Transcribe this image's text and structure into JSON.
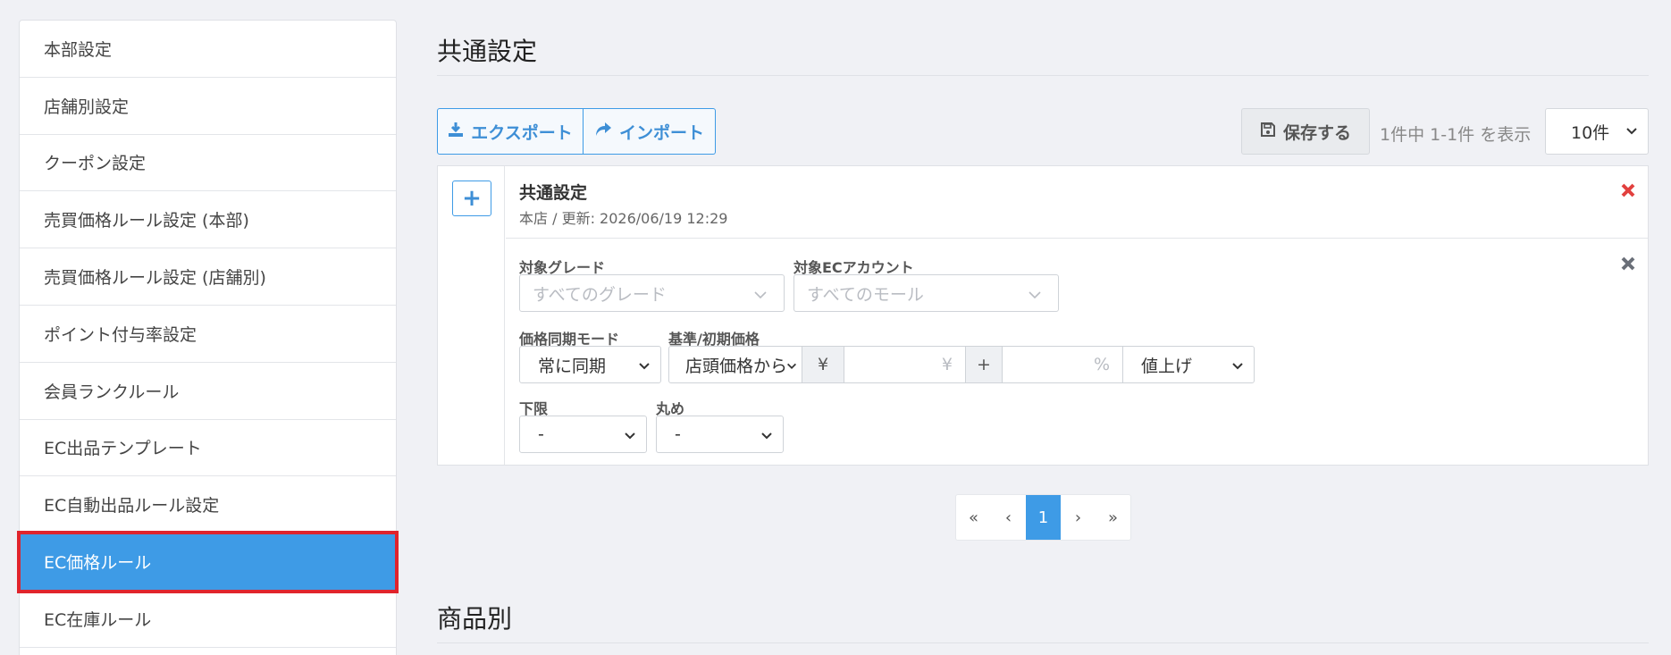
{
  "sidebar": {
    "items": [
      {
        "label": "本部設定"
      },
      {
        "label": "店舗別設定"
      },
      {
        "label": "クーポン設定"
      },
      {
        "label": "売買価格ルール設定 (本部)"
      },
      {
        "label": "売買価格ルール設定 (店舗別)"
      },
      {
        "label": "ポイント付与率設定"
      },
      {
        "label": "会員ランクルール"
      },
      {
        "label": "EC出品テンプレート"
      },
      {
        "label": "EC自動出品ルール設定"
      },
      {
        "label": "EC価格ルール"
      },
      {
        "label": "EC在庫ルール"
      }
    ],
    "active_index": 9
  },
  "main": {
    "section1_title": "共通設定",
    "export_label": "エクスポート",
    "import_label": "インポート",
    "save_label": "保存する",
    "count_text": "1件中 1-1件 を表示",
    "per_page": "10件",
    "card": {
      "plus": "+",
      "title": "共通設定",
      "meta": "本店 / 更新: 2026/06/19 12:29",
      "grade_label": "対象グレード",
      "grade_placeholder": "すべてのグレード",
      "ec_account_label": "対象ECアカウント",
      "ec_account_placeholder": "すべてのモール",
      "sync_mode_label": "価格同期モード",
      "sync_mode_value": "常に同期",
      "base_price_label": "基準/初期価格",
      "base_price_value": "店頭価格から",
      "yen_addon": "¥",
      "yen_placeholder": "¥",
      "plus_addon": "+",
      "percent_placeholder": "%",
      "direction_value": "値上げ",
      "lower_label": "下限",
      "lower_value": "-",
      "rounding_label": "丸め",
      "rounding_value": "-"
    },
    "pagination": {
      "first": "«",
      "prev": "‹",
      "current": "1",
      "next": "›",
      "last": "»"
    },
    "section2_title": "商品別"
  },
  "colors": {
    "accent": "#3e9be6",
    "highlight_outline": "#e0242c",
    "delete_red": "#e2403e"
  }
}
